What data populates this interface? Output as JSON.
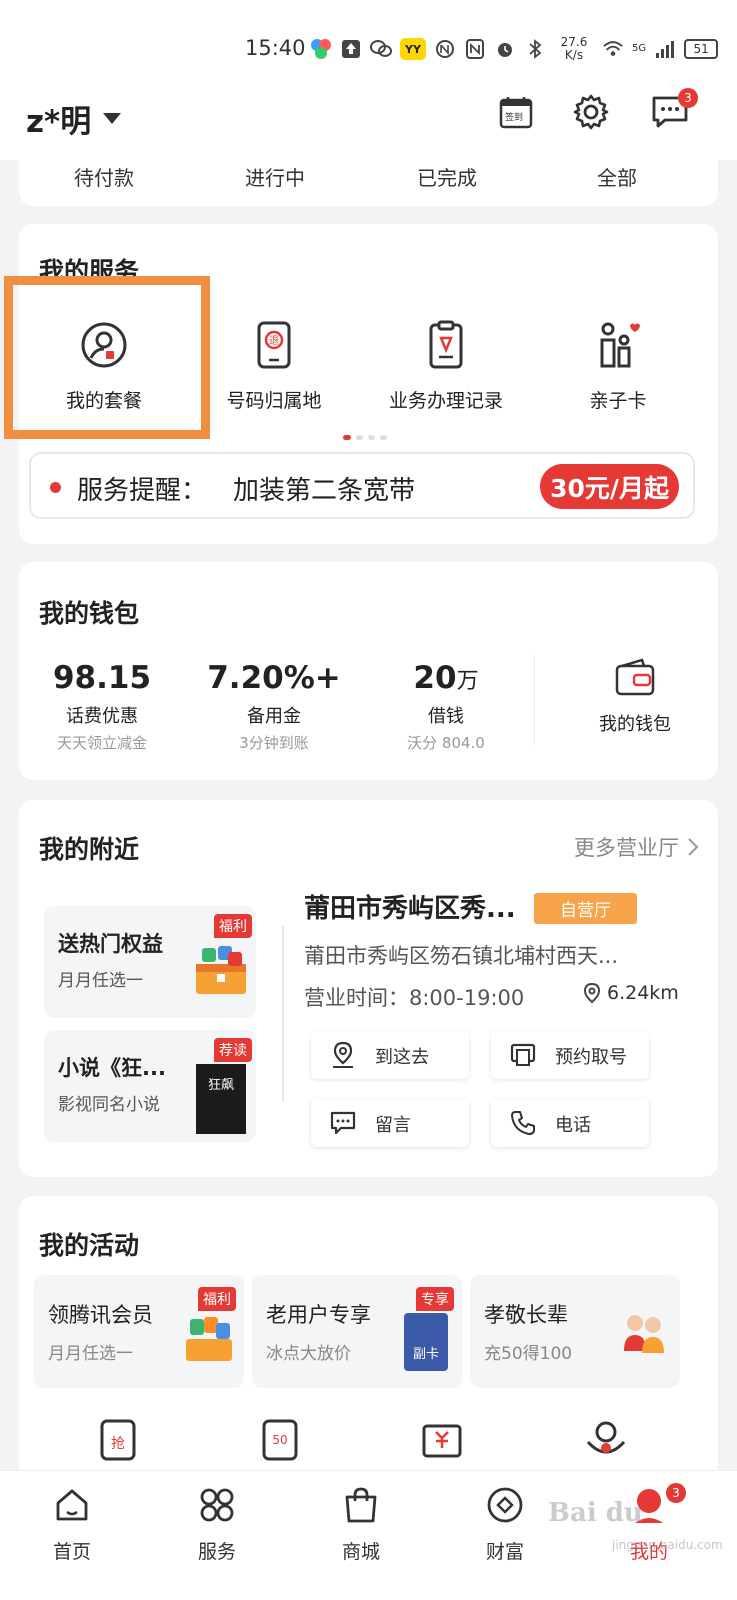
{
  "status_bar": {
    "time": "15:40",
    "net_speed": "27.6 K/s",
    "yy_label": "YY",
    "network": "5G",
    "battery": "51"
  },
  "header": {
    "username": "z*明",
    "checkin_label": "签到",
    "message_count": "3"
  },
  "orders": {
    "tabs": [
      "待付款",
      "进行中",
      "已完成",
      "全部"
    ]
  },
  "services": {
    "title": "我的服务",
    "items": [
      {
        "label": "我的套餐",
        "icon": "plan-user-icon"
      },
      {
        "label": "号码归属地",
        "icon": "phone-location-icon"
      },
      {
        "label": "业务办理记录",
        "icon": "business-record-icon"
      },
      {
        "label": "亲子卡",
        "icon": "parent-child-card-icon"
      }
    ],
    "reminder_label": "服务提醒：",
    "reminder_text": "加装第二条宽带",
    "reminder_price": "30元/月起"
  },
  "wallet": {
    "title": "我的钱包",
    "items": [
      {
        "value": "98.15",
        "unit": "",
        "label": "话费优惠",
        "sub": "天天领立减金"
      },
      {
        "value": "7.20%+",
        "unit": "",
        "label": "备用金",
        "sub": "3分钟到账"
      },
      {
        "value": "20",
        "unit": "万",
        "label": "借钱",
        "sub": "沃分 804.0"
      }
    ],
    "wallet_link": "我的钱包"
  },
  "nearby": {
    "title": "我的附近",
    "more": "更多营业厅",
    "promos": [
      {
        "title": "送热门权益",
        "sub": "月月任选一",
        "tag": "福利"
      },
      {
        "title": "小说《狂...",
        "sub": "影视同名小说",
        "tag": "荐读",
        "cover_text": "狂飙"
      }
    ],
    "store": {
      "name": "莆田市秀屿区秀...",
      "tag": "自营厅",
      "address": "莆田市秀屿区笏石镇北埔村西天...",
      "hours": "营业时间：8:00-19:00",
      "distance": "6.24km"
    },
    "actions": [
      "到这去",
      "预约取号",
      "留言",
      "电话"
    ]
  },
  "activities": {
    "title": "我的活动",
    "items": [
      {
        "title": "领腾讯会员",
        "sub": "月月任选一",
        "tag": "福利"
      },
      {
        "title": "老用户专享",
        "sub": "冰点大放价",
        "tag": "专享",
        "card_text": "副卡"
      },
      {
        "title": "孝敬长辈",
        "sub": "充50得100",
        "tag": ""
      }
    ],
    "mini_icons": [
      "抢",
      "50"
    ]
  },
  "bottom_nav": {
    "items": [
      "首页",
      "服务",
      "商城",
      "财富",
      "我的"
    ],
    "active": "我的",
    "badge": "3"
  },
  "watermark": {
    "text": "Bai du",
    "sub": "jingyan.baidu.com"
  },
  "colors": {
    "accent": "#e53935",
    "highlight": "#f08f3f",
    "store_tag": "#f7a34a"
  }
}
